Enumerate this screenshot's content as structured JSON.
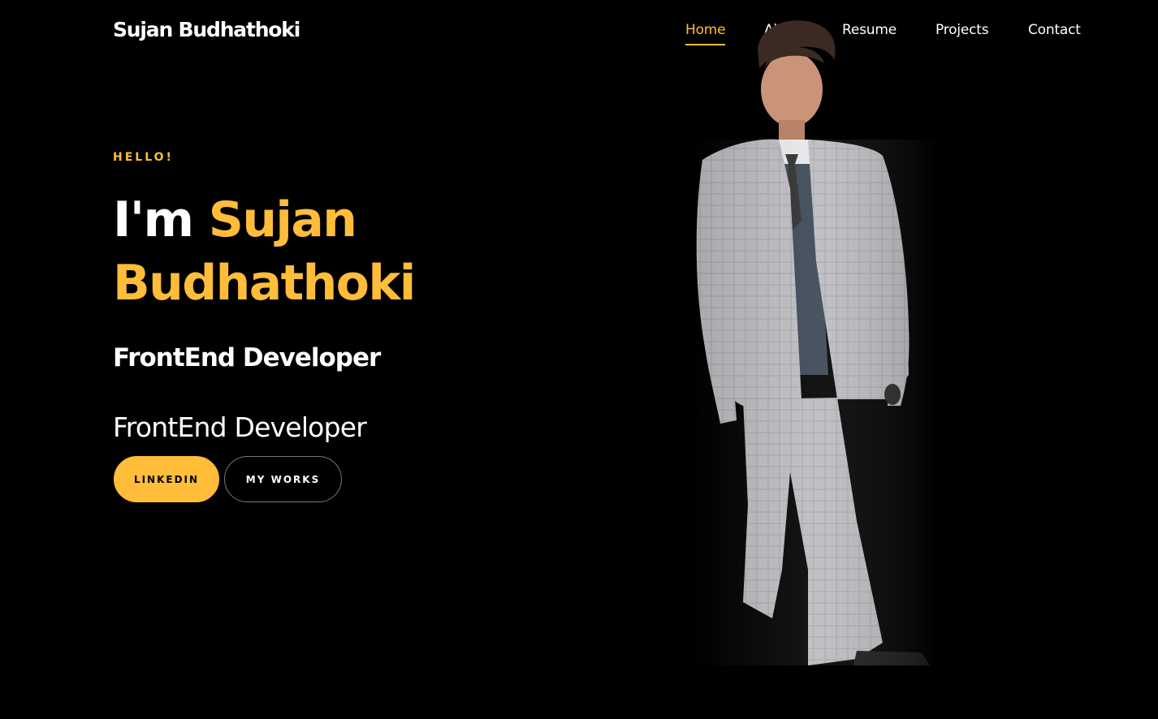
{
  "brand": "Sujan Budhathoki",
  "nav": {
    "items": [
      {
        "label": "Home",
        "active": true
      },
      {
        "label": "About",
        "active": false
      },
      {
        "label": "Resume",
        "active": false
      },
      {
        "label": "Projects",
        "active": false
      },
      {
        "label": "Contact",
        "active": false
      }
    ]
  },
  "hero": {
    "subheading": "HELLO!",
    "title_prefix": "I'm ",
    "name_first": "Sujan",
    "name_last": "Budhathoki",
    "role_bold": "FrontEnd Developer",
    "role_light": "FrontEnd Developer",
    "buttons": {
      "primary": "LINKEDIN",
      "secondary": "MY WORKS"
    }
  },
  "colors": {
    "accent": "#ffbd39",
    "background": "#000000",
    "text": "#ffffff"
  }
}
